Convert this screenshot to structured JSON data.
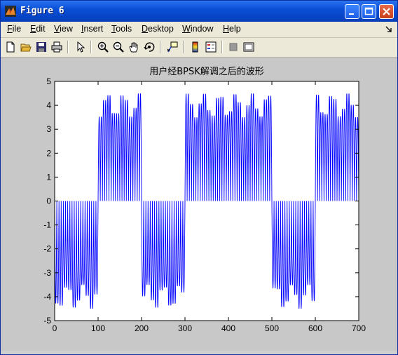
{
  "window": {
    "title": "Figure 6",
    "colors": {
      "titlebar": "#0a4fd6",
      "menubar": "#ece9d8",
      "figure_bg": "#c8c8c8",
      "plot_line": "#0000ff"
    }
  },
  "menu": {
    "items": [
      {
        "label": "File",
        "underline": "F"
      },
      {
        "label": "Edit",
        "underline": "E"
      },
      {
        "label": "View",
        "underline": "V"
      },
      {
        "label": "Insert",
        "underline": "I"
      },
      {
        "label": "Tools",
        "underline": "T"
      },
      {
        "label": "Desktop",
        "underline": "D"
      },
      {
        "label": "Window",
        "underline": "W"
      },
      {
        "label": "Help",
        "underline": "H"
      }
    ],
    "dock_icon": "dock-arrow-icon"
  },
  "toolbar": {
    "buttons": [
      "new-figure-icon",
      "open-file-icon",
      "save-icon",
      "print-icon",
      "pointer-icon",
      "zoom-in-icon",
      "zoom-out-icon",
      "pan-hand-icon",
      "rotate-3d-icon",
      "data-cursor-icon",
      "colorbar-icon",
      "legend-icon",
      "hide-plot-tools-icon",
      "show-plot-tools-icon"
    ]
  },
  "chart_data": {
    "type": "line",
    "title": "用户经BPSK解调之后的波形",
    "xlabel": "",
    "ylabel": "",
    "xlim": [
      0,
      700
    ],
    "ylim": [
      -5,
      5
    ],
    "x_ticks": [
      "0",
      "100",
      "200",
      "300",
      "400",
      "500",
      "600",
      "700"
    ],
    "y_ticks": [
      "5",
      "4",
      "3",
      "2",
      "1",
      "0",
      "-1",
      "-2",
      "-3",
      "-4",
      "-5"
    ],
    "grid": false,
    "series": [
      {
        "description": "rectified carrier, sign follows BPSK bits",
        "segments": [
          {
            "x_start": 0,
            "x_end": 100,
            "sign": -1
          },
          {
            "x_start": 100,
            "x_end": 200,
            "sign": 1
          },
          {
            "x_start": 200,
            "x_end": 300,
            "sign": -1
          },
          {
            "x_start": 300,
            "x_end": 500,
            "sign": 1
          },
          {
            "x_start": 500,
            "x_end": 600,
            "sign": -1
          },
          {
            "x_start": 600,
            "x_end": 700,
            "sign": 1
          }
        ],
        "cycles_per_100": 10,
        "peak_amplitude_range": [
          3.5,
          4.5
        ]
      }
    ]
  }
}
